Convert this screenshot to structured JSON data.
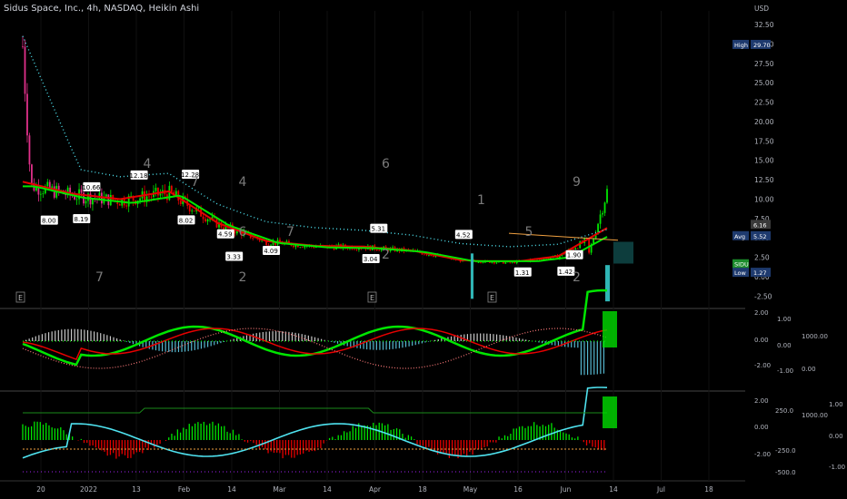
{
  "header": {
    "title": "Sidus Space, Inc., 4h, NASDAQ, Heikin Ashi",
    "currency": "USD"
  },
  "price_axis": {
    "ticks": [
      "32.50",
      "30.00",
      "27.50",
      "25.00",
      "22.50",
      "20.00",
      "17.50",
      "15.00",
      "12.50",
      "10.00",
      "7.50",
      "5.00",
      "2.50",
      "0.00",
      "-2.50"
    ],
    "badges": {
      "high_label": "High",
      "high_value": "29.70",
      "avg_label": "Avg",
      "avg_value": "5.52",
      "last_value": "6.16",
      "symbol": "SIDU",
      "low_label": "Low",
      "low_value": "1.27"
    }
  },
  "panel2_axis": {
    "left_ticks": [
      "2.00",
      "0.00",
      "-2.00"
    ],
    "mid_ticks": [
      "1.00",
      "0.00",
      "-1.00"
    ],
    "right_ticks": [
      "1000.00",
      "0.00"
    ]
  },
  "panel3_axis": {
    "left_ticks": [
      "2.00",
      "0.00",
      "-2.00"
    ],
    "mid_ticks": [
      "250.0",
      "-250.0",
      "-500.0"
    ],
    "mid2_ticks": [
      "1000.00"
    ],
    "right_ticks": [
      "1.00",
      "0.00",
      "-1.00"
    ]
  },
  "time_axis": [
    "20",
    "2022",
    "13",
    "Feb",
    "14",
    "Mar",
    "14",
    "Apr",
    "18",
    "May",
    "16",
    "Jun",
    "14",
    "Jul",
    "18"
  ],
  "colors": {
    "background": "#000000",
    "up": "#00e600",
    "down": "#e60000",
    "pink": "#e0308a",
    "teal": "#2fb5b5",
    "cyan": "#4fe3f0",
    "orange": "#f0a040",
    "label_blue": "#1e3a6e"
  },
  "chart_data": {
    "type": "candlestick",
    "title": "Sidus Space, Inc., 4h, NASDAQ, Heikin Ashi",
    "ylim": [
      -2.5,
      32.5
    ],
    "ohlc_weekly_approx": [
      {
        "t": "20",
        "o": 29.7,
        "h": 29.7,
        "l": 8.0,
        "c": 12.0
      },
      {
        "t": "2022",
        "o": 12.0,
        "h": 13.0,
        "l": 8.4,
        "c": 10.5
      },
      {
        "t": "13",
        "o": 10.5,
        "h": 12.2,
        "l": 8.5,
        "c": 9.8
      },
      {
        "t": "Feb",
        "o": 9.8,
        "h": 12.3,
        "l": 8.2,
        "c": 10.8
      },
      {
        "t": "14",
        "o": 10.8,
        "h": 11.2,
        "l": 6.0,
        "c": 6.8
      },
      {
        "t": "Mar",
        "o": 6.8,
        "h": 7.2,
        "l": 3.9,
        "c": 4.5
      },
      {
        "t": "14",
        "o": 4.5,
        "h": 5.0,
        "l": 3.2,
        "c": 3.9
      },
      {
        "t": "Apr",
        "o": 3.9,
        "h": 5.3,
        "l": 3.0,
        "c": 3.8
      },
      {
        "t": "18",
        "o": 3.8,
        "h": 4.2,
        "l": 2.9,
        "c": 3.3
      },
      {
        "t": "May",
        "o": 3.3,
        "h": 4.5,
        "l": 1.3,
        "c": 2.1
      },
      {
        "t": "16",
        "o": 2.1,
        "h": 2.6,
        "l": 1.3,
        "c": 1.8
      },
      {
        "t": "Jun",
        "o": 1.8,
        "h": 3.0,
        "l": 1.4,
        "c": 2.6
      },
      {
        "t": "14",
        "o": 2.6,
        "h": 10.8,
        "l": 1.3,
        "c": 6.16
      }
    ],
    "annotations": [
      {
        "text": "10.66",
        "x_label": "2022",
        "value": 10.66,
        "kind": "high"
      },
      {
        "text": "8.00",
        "x_label": "20",
        "value": 8.0,
        "kind": "low"
      },
      {
        "text": "8.19",
        "x_label": "2022",
        "value": 8.19,
        "kind": "low"
      },
      {
        "text": "12.18",
        "x_label": "13",
        "value": 12.18,
        "kind": "high"
      },
      {
        "text": "12.28",
        "x_label": "Feb",
        "value": 12.28,
        "kind": "high"
      },
      {
        "text": "8.02",
        "x_label": "Feb",
        "value": 8.02,
        "kind": "low"
      },
      {
        "text": "4.09",
        "x_label": "Mar",
        "value": 4.09,
        "kind": "low"
      },
      {
        "text": "3.33",
        "x_label": "14",
        "value": 3.33,
        "kind": "low"
      },
      {
        "text": "4.59",
        "x_label": "14",
        "value": 4.59,
        "kind": "high"
      },
      {
        "text": "3.04",
        "x_label": "Apr",
        "value": 3.04,
        "kind": "low"
      },
      {
        "text": "5.31",
        "x_label": "Apr",
        "value": 5.31,
        "kind": "high"
      },
      {
        "text": "4.52",
        "x_label": "May",
        "value": 4.52,
        "kind": "high"
      },
      {
        "text": "1.31",
        "x_label": "16",
        "value": 1.31,
        "kind": "low"
      },
      {
        "text": "1.42",
        "x_label": "Jun",
        "value": 1.42,
        "kind": "low"
      },
      {
        "text": "1.90",
        "x_label": "Jun",
        "value": 1.9,
        "kind": "high"
      }
    ],
    "td_counts": [
      {
        "text": "4",
        "x_label": "13",
        "pos": "above"
      },
      {
        "text": "7",
        "x_label": "Feb",
        "pos": "above"
      },
      {
        "text": "7",
        "x_label": "2022",
        "pos": "below"
      },
      {
        "text": "7",
        "x_label": "Mar",
        "pos": "below"
      },
      {
        "text": "4",
        "x_label": "14",
        "pos": "above"
      },
      {
        "text": "2",
        "x_label": "14",
        "pos": "below"
      },
      {
        "text": "6",
        "x_label": "Apr",
        "pos": "above"
      },
      {
        "text": "2",
        "x_label": "Apr",
        "pos": "below"
      },
      {
        "text": "1",
        "x_label": "May",
        "pos": "above"
      },
      {
        "text": "5",
        "x_label": "16",
        "pos": "below"
      },
      {
        "text": "9",
        "x_label": "Jun",
        "pos": "above"
      },
      {
        "text": "2",
        "x_label": "Jun",
        "pos": "below"
      },
      {
        "text": "6",
        "x_label": "14",
        "pos": "below"
      }
    ],
    "earnings_markers": [
      "E",
      "E",
      "E"
    ]
  }
}
